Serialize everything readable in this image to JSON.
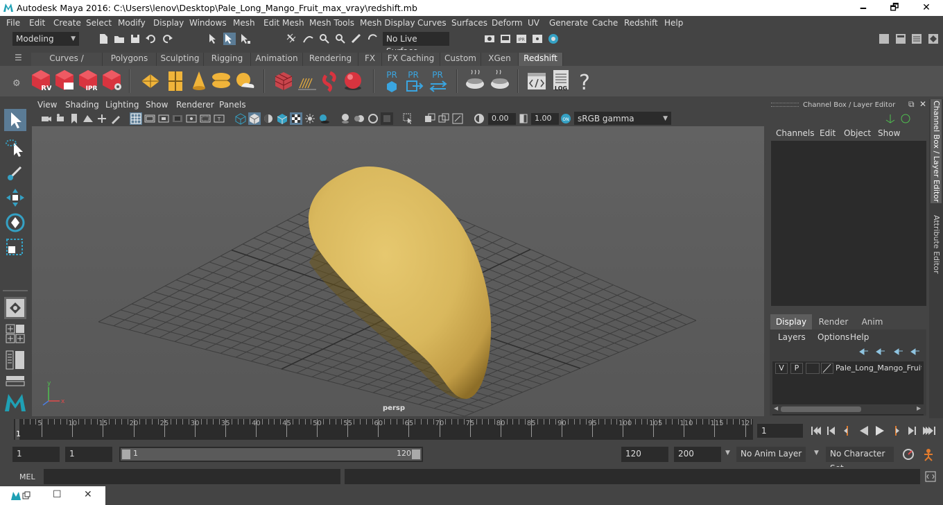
{
  "window": {
    "title": "Autodesk Maya 2016: C:\\Users\\lenov\\Desktop\\Pale_Long_Mango_Fruit_max_vray\\redshift.mb",
    "minimize": "🗕",
    "maximize": "🗗",
    "close": "✕"
  },
  "menubar": [
    "File",
    "Edit",
    "Create",
    "Select",
    "Modify",
    "Display",
    "Windows",
    "Mesh",
    "Edit Mesh",
    "Mesh Tools",
    "Mesh Display",
    "Curves",
    "Surfaces",
    "Deform",
    "UV",
    "Generate",
    "Cache",
    "Redshift",
    "Help"
  ],
  "statusline": {
    "mode": "Modeling",
    "live_surface": "No Live Surface"
  },
  "shelf_tabs": [
    "Curves / Surfaces",
    "Polygons",
    "Sculpting",
    "Rigging",
    "Animation",
    "Rendering",
    "FX",
    "FX Caching",
    "Custom",
    "XGen",
    "Redshift"
  ],
  "shelf_active_tab": "Redshift",
  "shelf_labels": {
    "rv": "RV",
    "ipr": "IPR",
    "pr": "PR",
    "log": "LOG",
    "help": "?"
  },
  "panel_menu": [
    "View",
    "Shading",
    "Lighting",
    "Show",
    "Renderer",
    "Panels"
  ],
  "panel_tools": {
    "exposure": "0.00",
    "gamma": "1.00",
    "color_space": "sRGB gamma"
  },
  "viewport": {
    "camera": "persp",
    "axis_y": "y",
    "axis_x": "x"
  },
  "channel_box": {
    "title": "Channel Box / Layer Editor",
    "menu": [
      "Channels",
      "Edit",
      "Object",
      "Show"
    ]
  },
  "side_tabs": [
    "Channel Box / Layer Editor",
    "Attribute Editor"
  ],
  "layer_editor": {
    "tabs": [
      "Display",
      "Render",
      "Anim"
    ],
    "active_tab": "Display",
    "menu": [
      "Layers",
      "Options",
      "Help"
    ],
    "layer": {
      "v": "V",
      "p": "P",
      "name": "Pale_Long_Mango_Fruit_"
    }
  },
  "timeline": {
    "labels": [
      "1",
      "5",
      "10",
      "15",
      "20",
      "25",
      "30",
      "35",
      "40",
      "45",
      "50",
      "55",
      "60",
      "65",
      "70",
      "75",
      "80",
      "85",
      "90",
      "95",
      "100",
      "105",
      "110",
      "115",
      "12"
    ],
    "current_frame": "1",
    "current_frame_label": "1"
  },
  "range": {
    "start": "1",
    "playback_start": "1",
    "slider_start": "1",
    "slider_end": "120",
    "playback_end": "120",
    "end": "200",
    "anim_layer": "No Anim Layer",
    "character_set": "No Character Set"
  },
  "command_line": {
    "label": "MEL"
  }
}
